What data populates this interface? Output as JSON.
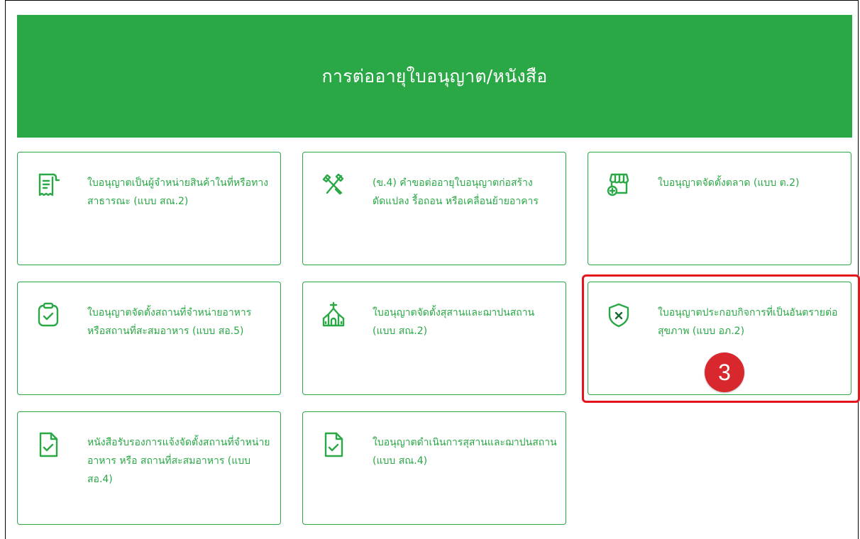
{
  "header": {
    "title": "การต่ออายุใบอนุญาต/หนังสือ"
  },
  "cards": [
    {
      "label": "ใบอนุญาตเป็นผู้จำหน่ายสินค้าในที่หรือทางสาธารณะ (แบบ สณ.2)",
      "icon": "receipt-icon"
    },
    {
      "label": "(ข.4) คำขอต่ออายุใบอนุญาตก่อสร้าง ดัดแปลง รื้อถอน หรือเคลื่อนย้ายอาคาร",
      "icon": "construction-tools-icon"
    },
    {
      "label": "ใบอนุญาตจัดตั้งตลาด (แบบ ต.2)",
      "icon": "market-store-icon"
    },
    {
      "label": "ใบอนุญาตจัดตั้งสถานที่จำหน่ายอาหาร หรือสถานที่สะสมอาหาร (แบบ สอ.5)",
      "icon": "clipboard-check-icon"
    },
    {
      "label": "ใบอนุญาตจัดตั้งสุสานและฌาปนสถาน (แบบ สณ.2)",
      "icon": "church-icon"
    },
    {
      "label": "ใบอนุญาตประกอบกิจการที่เป็นอันตรายต่อสุขภาพ (แบบ อภ.2)",
      "icon": "shield-x-icon"
    },
    {
      "label": "หนังสือรับรองการแจ้งจัดตั้งสถานที่จำหน่ายอาหาร หรือ สถานที่สะสมอาหาร (แบบ สอ.4)",
      "icon": "document-check-icon"
    },
    {
      "label": "ใบอนุญาตดำเนินการสุสานและฌาปนสถาน (แบบ สณ.4)",
      "icon": "document-check-icon"
    }
  ],
  "annotation": {
    "step": "3",
    "color": "#e3141b"
  },
  "colors": {
    "accent": "#2aa846",
    "highlight": "#e3141b"
  }
}
